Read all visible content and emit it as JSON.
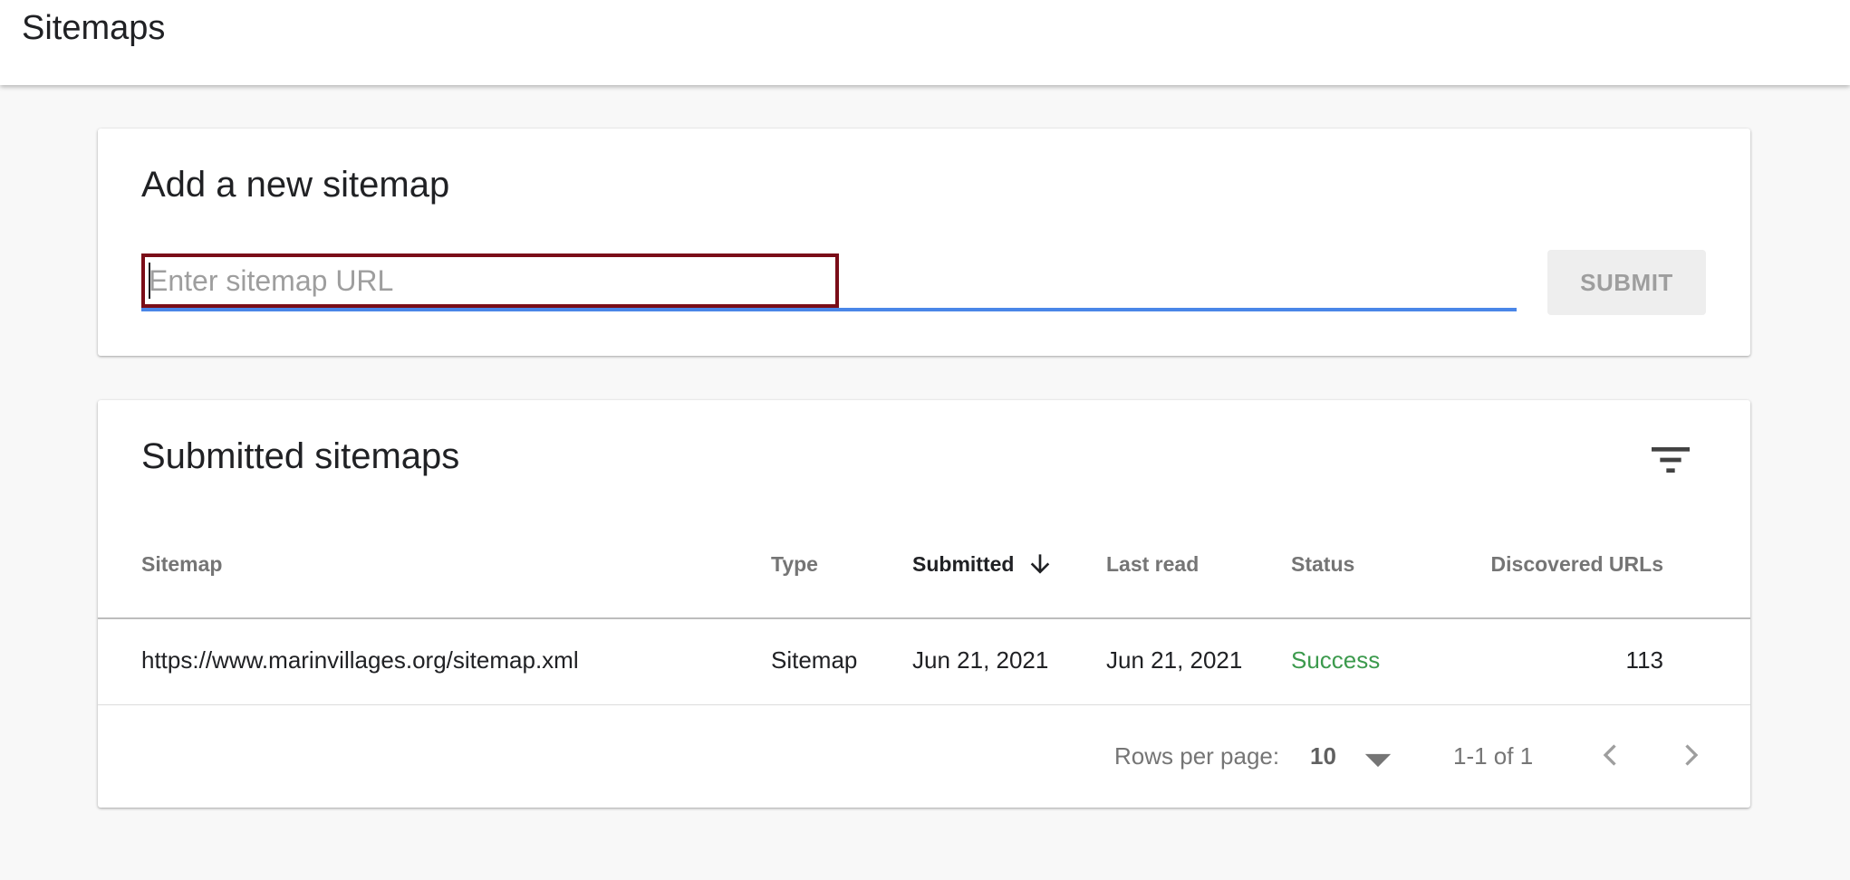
{
  "header": {
    "title": "Sitemaps"
  },
  "add_card": {
    "title": "Add a new sitemap",
    "input": {
      "placeholder": "Enter sitemap URL",
      "value": ""
    },
    "submit_label": "SUBMIT"
  },
  "list_card": {
    "title": "Submitted sitemaps",
    "columns": {
      "sitemap": "Sitemap",
      "type": "Type",
      "submitted": "Submitted",
      "last_read": "Last read",
      "status": "Status",
      "discovered_urls": "Discovered URLs"
    },
    "rows": [
      {
        "sitemap": "https://www.marinvillages.org/sitemap.xml",
        "type": "Sitemap",
        "submitted": "Jun 21, 2021",
        "last_read": "Jun 21, 2021",
        "status": "Success",
        "discovered_urls": "113"
      }
    ],
    "pagination": {
      "rows_per_page_label": "Rows per page:",
      "rows_per_page_value": "10",
      "range": "1-1 of 1"
    }
  },
  "icons": {
    "filter": "filter-icon",
    "sort": "arrow-down-icon",
    "dropdown": "caret-down-icon",
    "prev": "chevron-left-icon",
    "next": "chevron-right-icon"
  },
  "colors": {
    "accent": "#4a86e8",
    "success": "#3c9a4d",
    "highlight_border": "#7a0d18"
  }
}
